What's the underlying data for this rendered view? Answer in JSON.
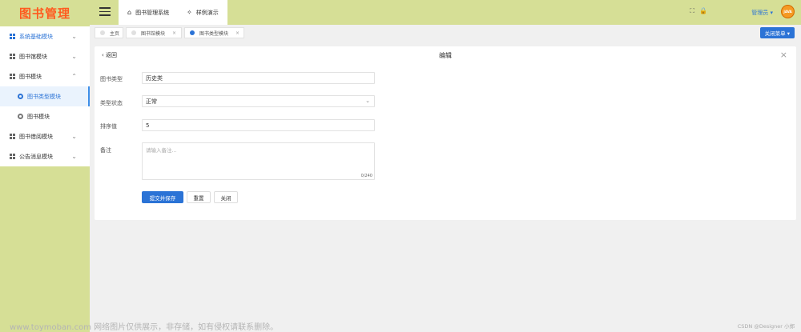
{
  "logo": {
    "text": "图书管理"
  },
  "sidebar": {
    "items": [
      {
        "label": "系统基础模块"
      },
      {
        "label": "图书馆模块"
      },
      {
        "label": "图书模块"
      },
      {
        "label": "图书类型模块"
      },
      {
        "label": "图书模块"
      },
      {
        "label": "图书借阅模块"
      },
      {
        "label": "公告消息模块"
      }
    ]
  },
  "header": {
    "tabs": [
      {
        "label": "图书管理系统",
        "icon": "home-icon"
      },
      {
        "label": "样例演示",
        "icon": "sun-icon"
      }
    ],
    "admin_label": "管理员 ▾",
    "avatar_text": "JAVA",
    "accent": "#2b73d6",
    "bg": "#d6df96"
  },
  "tabbar": {
    "tabs": [
      {
        "label": "主页"
      },
      {
        "label": "图书馆模块",
        "close": "×"
      },
      {
        "label": "图书类型模块",
        "close": "×"
      }
    ],
    "close_menu": "关闭菜单 ▾"
  },
  "form": {
    "back": "‹ 返回",
    "title": "编辑",
    "close": "×",
    "fields": {
      "type_label": "图书类型",
      "type_value": "历史类",
      "status_label": "类型状态",
      "status_value": "正常",
      "sort_label": "排序值",
      "sort_value": "5",
      "remark_label": "备注",
      "remark_placeholder": "请输入备注...",
      "remark_counter": "0/240"
    },
    "buttons": {
      "submit": "提交并保存",
      "reset": "重置",
      "close": "关闭"
    }
  },
  "watermark": {
    "left": "www.toymoban.com 网络图片仅供展示，非存储，如有侵权请联系删除。",
    "right": "CSDN @Designer 小郑"
  }
}
